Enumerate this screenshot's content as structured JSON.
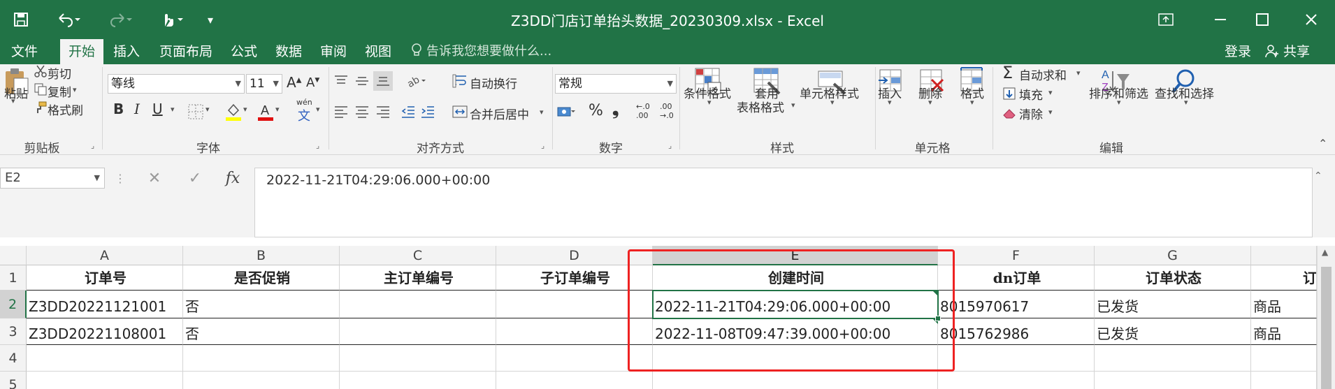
{
  "window": {
    "title": "Z3DD门店订单抬头数据_20230309.xlsx - Excel"
  },
  "qat": {
    "customize_icon": "▾"
  },
  "tabs": [
    {
      "label": "文件"
    },
    {
      "label": "开始"
    },
    {
      "label": "插入"
    },
    {
      "label": "页面布局"
    },
    {
      "label": "公式"
    },
    {
      "label": "数据"
    },
    {
      "label": "审阅"
    },
    {
      "label": "视图"
    }
  ],
  "tell_me": "告诉我您想要做什么...",
  "login": "登录",
  "share": "共享",
  "ribbon": {
    "clipboard": {
      "paste": "粘贴",
      "cut": "剪切",
      "copy": "复制",
      "format_painter": "格式刷",
      "group": "剪贴板"
    },
    "font": {
      "name": "等线",
      "size": "11",
      "bold": "B",
      "italic": "I",
      "underline": "U",
      "phonetic_top": "wén",
      "phonetic_bottom": "文",
      "group": "字体"
    },
    "alignment": {
      "wrap_text": "自动换行",
      "merge_center": "合并后居中",
      "group": "对齐方式"
    },
    "number": {
      "format": "常规",
      "percent": "%",
      "comma": "❟",
      "inc_decimal": "←.0\n.00",
      "dec_decimal": ".00\n→.0",
      "group": "数字"
    },
    "styles": {
      "conditional": "条件格式",
      "format_table_1": "套用",
      "format_table_2": "表格格式",
      "cell_styles": "单元格样式",
      "group": "样式"
    },
    "cells": {
      "insert": "插入",
      "delete": "删除",
      "format": "格式",
      "group": "单元格"
    },
    "editing": {
      "autosum": "自动求和",
      "fill": "填充",
      "clear": "清除",
      "sort_filter": "排序和筛选",
      "find_select": "查找和选择",
      "group": "编辑"
    }
  },
  "formula_bar": {
    "name_box": "E2",
    "fx": "fx",
    "value": "2022-11-21T04:29:06.000+00:00"
  },
  "sheet": {
    "columns": [
      "A",
      "B",
      "C",
      "D",
      "E",
      "F",
      "G"
    ],
    "rows": [
      "1",
      "2",
      "3",
      "4",
      "5"
    ],
    "header_row": [
      "订单号",
      "是否促销",
      "主订单编号",
      "子订单编号",
      "创建时间",
      "dn订单",
      "订单状态",
      "订"
    ],
    "data": [
      [
        "Z3DD20221121001",
        "否",
        "",
        "",
        "2022-11-21T04:29:06.000+00:00",
        "8015970617",
        "已发货",
        "商品"
      ],
      [
        "Z3DD20221108001",
        "否",
        "",
        "",
        "2022-11-08T09:47:39.000+00:00",
        "8015762986",
        "已发货",
        "商品"
      ]
    ]
  },
  "colors": {
    "excel_green": "#217346",
    "highlight_red": "#ee2222"
  }
}
